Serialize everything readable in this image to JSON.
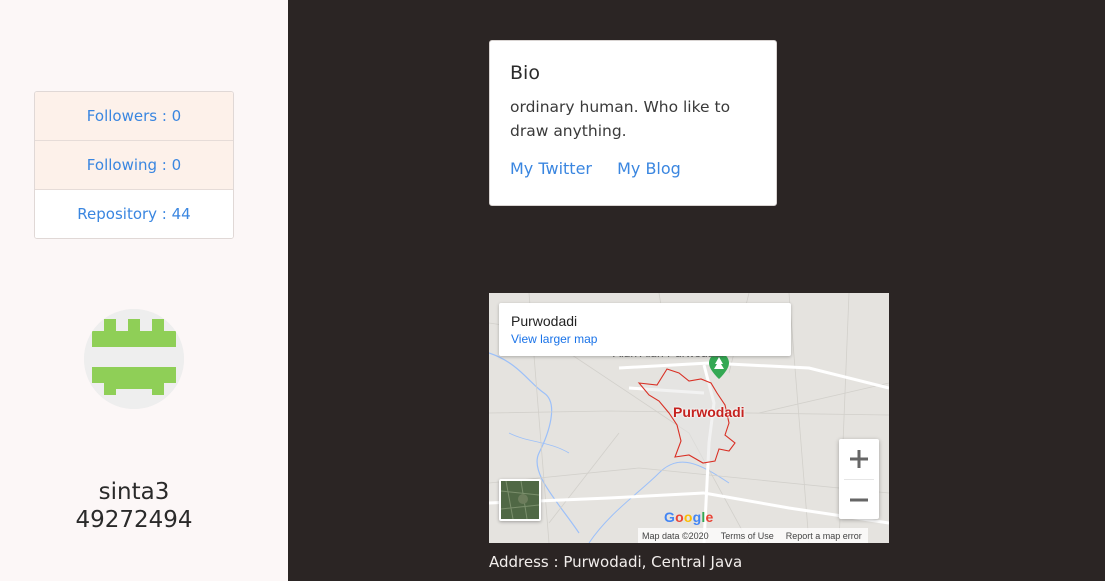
{
  "sidebar": {
    "stats": [
      {
        "label": "Followers : 0"
      },
      {
        "label": "Following : 0"
      },
      {
        "label": "Repository : 44"
      }
    ],
    "username_line1": "sinta3",
    "username_line2": "49272494"
  },
  "bio": {
    "title": "Bio",
    "text": "ordinary human. Who like to draw anything.",
    "links": [
      "My Twitter",
      "My Blog"
    ]
  },
  "map": {
    "place": "Purwodadi",
    "view_larger": "View larger map",
    "city_label": "Purwodadi",
    "top_label": "Alun Alun Purwodadi",
    "google_letters": [
      "G",
      "o",
      "o",
      "g",
      "l",
      "e"
    ],
    "footer": {
      "data": "Map data ©2020",
      "terms": "Terms of Use",
      "report": "Report a map error"
    },
    "zoom_in_icon": "plus-icon",
    "zoom_out_icon": "minus-icon"
  },
  "address": "Address : Purwodadi, Central Java",
  "colors": {
    "link": "#3a86e0",
    "dark_bg": "#2b2524",
    "sidebar_bg": "#fcf7f7",
    "avatar_green": "#8fcf57",
    "boundary_red": "#d93025"
  }
}
